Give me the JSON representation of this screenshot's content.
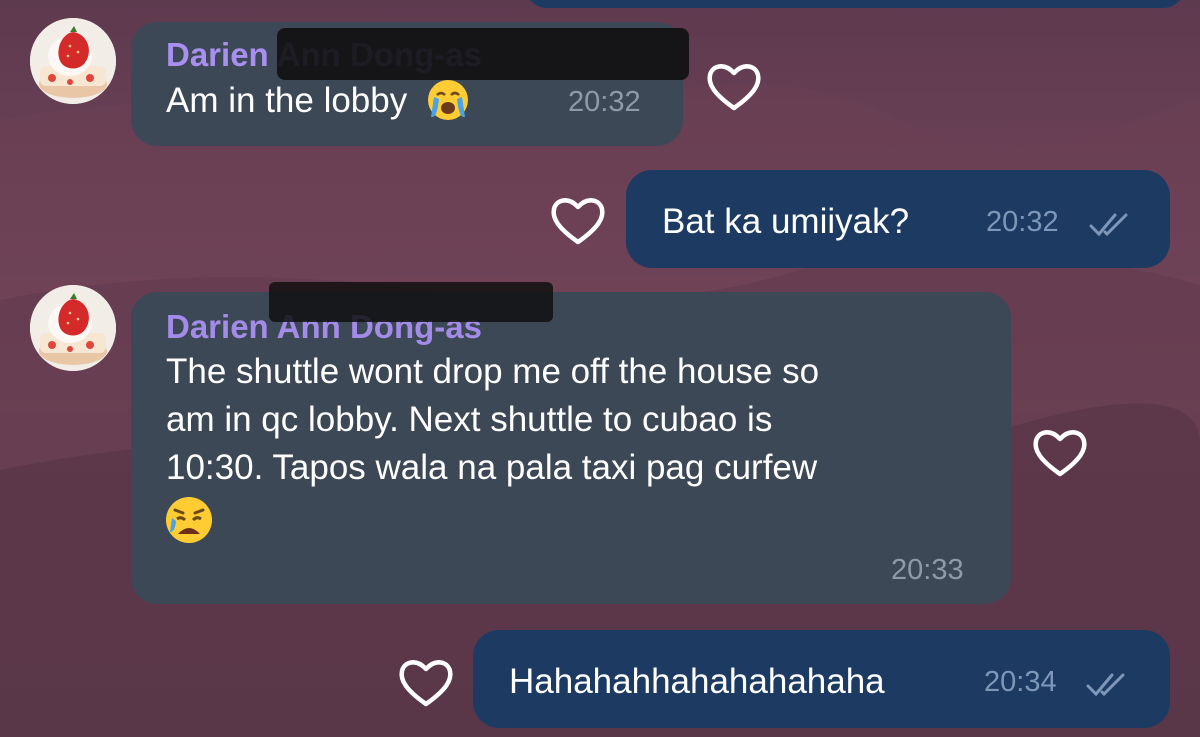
{
  "colors": {
    "incoming_bubble": "#3d4856",
    "outgoing_bubble": "#1d3a63",
    "sender_name": "#a98ff0",
    "background": "#6e4257"
  },
  "messages": [
    {
      "direction": "incoming",
      "sender": "Darien Ann Dong-as",
      "text": "Am in the lobby",
      "emoji": "crying-face",
      "time": "20:32"
    },
    {
      "direction": "outgoing",
      "text": "Bat ka umiiyak?",
      "time": "20:32",
      "status": "read-double-check"
    },
    {
      "direction": "incoming",
      "sender": "Darien Ann Dong-as",
      "lines": [
        "The shuttle wont drop me off the house so",
        "am in qc lobby. Next shuttle to cubao is",
        "10:30. Tapos wala na pala taxi pag curfew"
      ],
      "emoji": "weary-crying-face",
      "time": "20:33"
    },
    {
      "direction": "outgoing",
      "text": "Hahahahhahahahahaha",
      "time": "20:34",
      "status": "read-double-check"
    }
  ],
  "icons": {
    "reaction": "heart-outline-icon",
    "read_status": "double-check-icon",
    "avatar": "strawberry-cake-avatar"
  }
}
